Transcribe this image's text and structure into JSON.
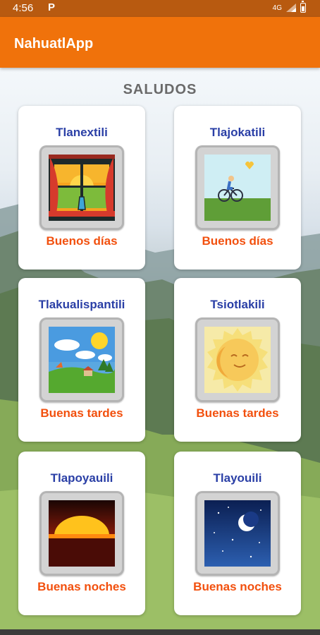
{
  "status_bar": {
    "time": "4:56",
    "notif_icon": "P",
    "network": "4G"
  },
  "app_bar": {
    "title": "NahuatlApp"
  },
  "section": {
    "title": "SALUDOS"
  },
  "cards": [
    {
      "word": "Tlanextili",
      "meaning": "Buenos días",
      "icon": "window-sunrise-icon"
    },
    {
      "word": "Tlajokatili",
      "meaning": "Buenos días",
      "icon": "cyclist-morning-icon"
    },
    {
      "word": "Tlakualispantili",
      "meaning": "Buenas tardes",
      "icon": "afternoon-landscape-icon"
    },
    {
      "word": "Tsiotlakili",
      "meaning": "Buenas tardes",
      "icon": "smiling-sun-icon"
    },
    {
      "word": "Tlapoyauili",
      "meaning": "Buenas noches",
      "icon": "sunset-icon"
    },
    {
      "word": "Tlayouili",
      "meaning": "Buenas noches",
      "icon": "moon-night-icon"
    }
  ],
  "colors": {
    "app_bar": "#f0720b",
    "word": "#2a3fa6",
    "meaning": "#f2500e",
    "section_title": "#6a6a6a"
  }
}
